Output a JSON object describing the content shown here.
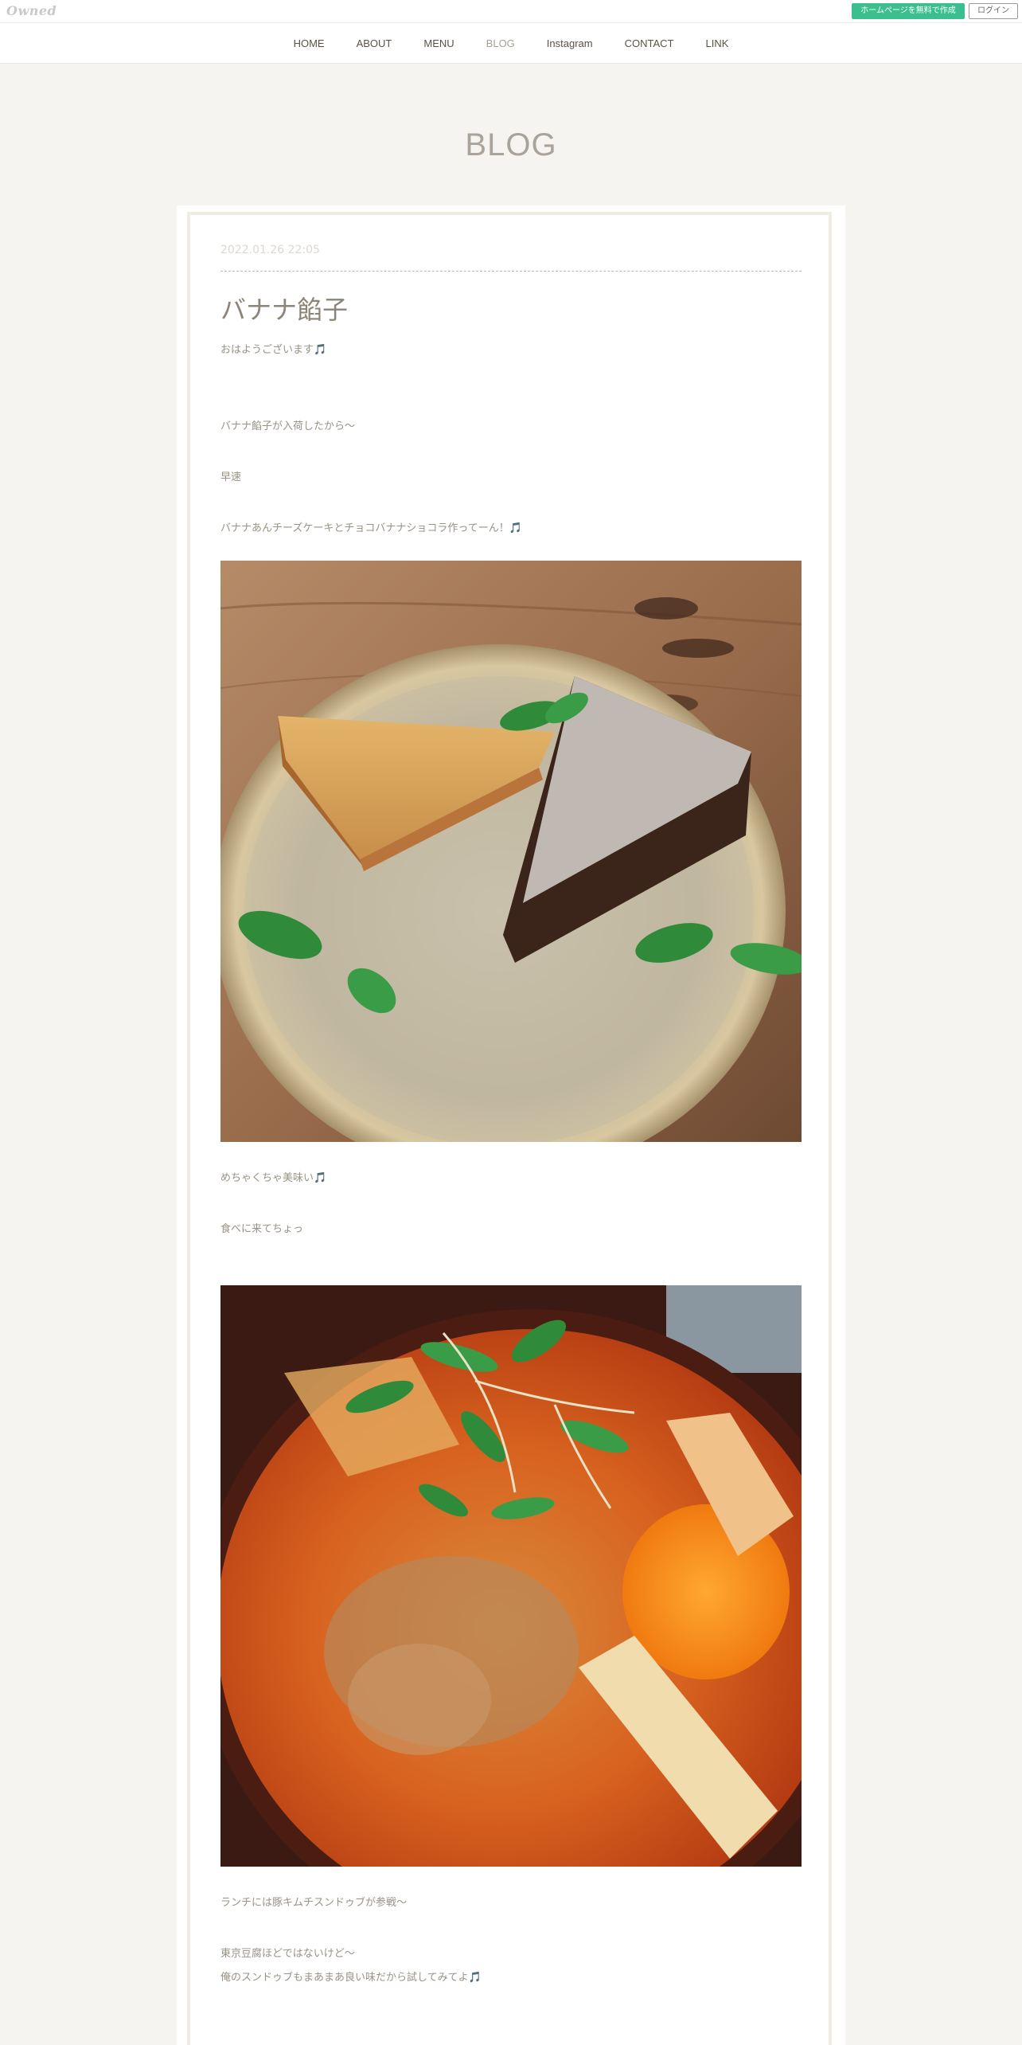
{
  "service_bar": {
    "logo": "Owned",
    "create_button": "ホームページを無料で作成",
    "login_button": "ログイン"
  },
  "nav": {
    "items": [
      {
        "label": "HOME"
      },
      {
        "label": "ABOUT"
      },
      {
        "label": "MENU"
      },
      {
        "label": "BLOG",
        "active": true
      },
      {
        "label": "Instagram"
      },
      {
        "label": "CONTACT"
      },
      {
        "label": "LINK"
      }
    ]
  },
  "page_heading": "BLOG",
  "post": {
    "date": "2022.01.26 22:05",
    "title": "バナナ餡子",
    "paragraphs": [
      "おはようございます🎵",
      "バナナ餡子が入荷したから〜",
      "早速",
      "バナナあんチーズケーキとチョコバナナショコラ作ってーん！🎵",
      "めちゃくちゃ美味い🎵",
      "食べに来てちょっ",
      "ランチには豚キムチスンドゥブが参戦〜",
      "東京豆腐ほどではないけど〜",
      "俺のスンドゥブもまあまあ良い味だから試してみてよ🎵"
    ]
  },
  "colors": {
    "page_bg": "#f5f4f0",
    "accent_green": "#3cbf8f",
    "nav_text": "#5a5245",
    "body_text": "#9a9286"
  }
}
